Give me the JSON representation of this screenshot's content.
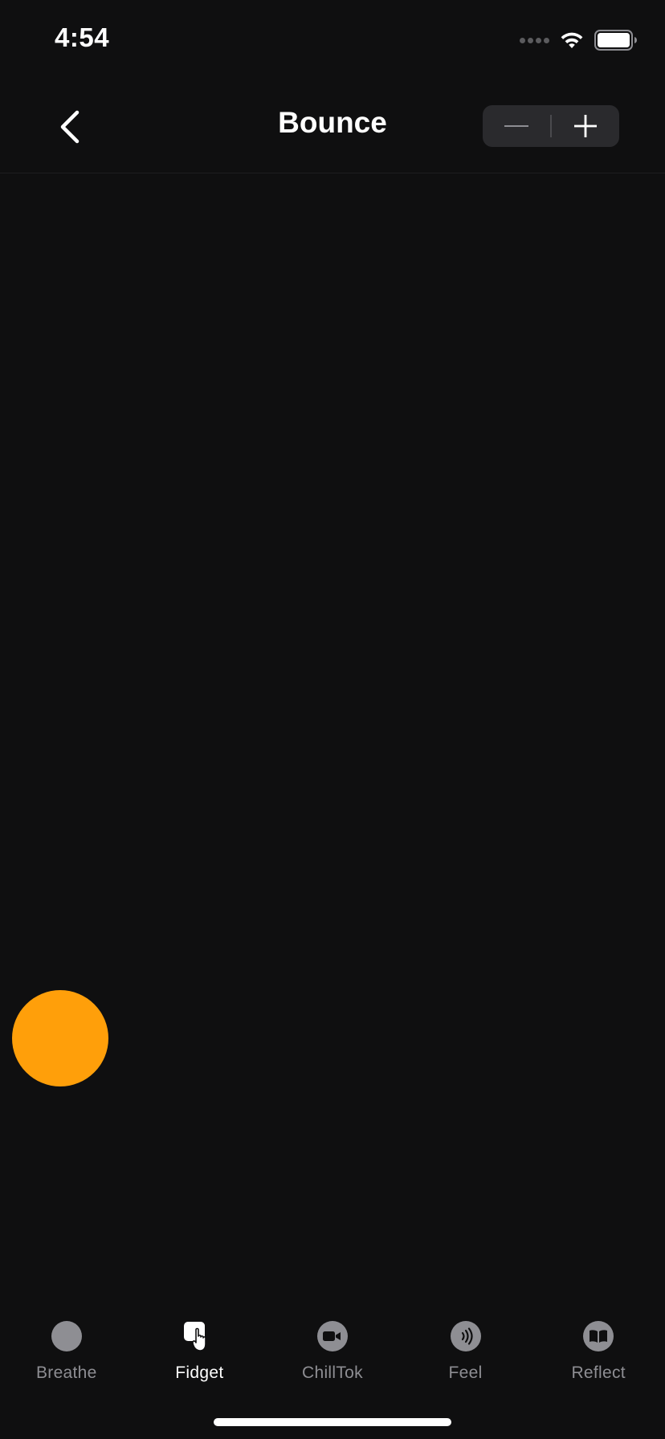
{
  "status_bar": {
    "time": "4:54"
  },
  "nav": {
    "title": "Bounce",
    "back_icon": "chevron-left-icon",
    "stepper": {
      "decrement_icon": "minus-icon",
      "increment_icon": "plus-icon"
    }
  },
  "ball": {
    "color": "#ff9f0a"
  },
  "tabs": [
    {
      "label": "Breathe",
      "icon": "circle-icon",
      "active": false
    },
    {
      "label": "Fidget",
      "icon": "hand-tap-icon",
      "active": true
    },
    {
      "label": "ChillTok",
      "icon": "video-icon",
      "active": false
    },
    {
      "label": "Feel",
      "icon": "vibration-icon",
      "active": false
    },
    {
      "label": "Reflect",
      "icon": "book-icon",
      "active": false
    }
  ],
  "colors": {
    "background": "#0f0f10",
    "accent": "#ff9f0a",
    "inactive": "#8e8e93",
    "active": "#ffffff"
  }
}
